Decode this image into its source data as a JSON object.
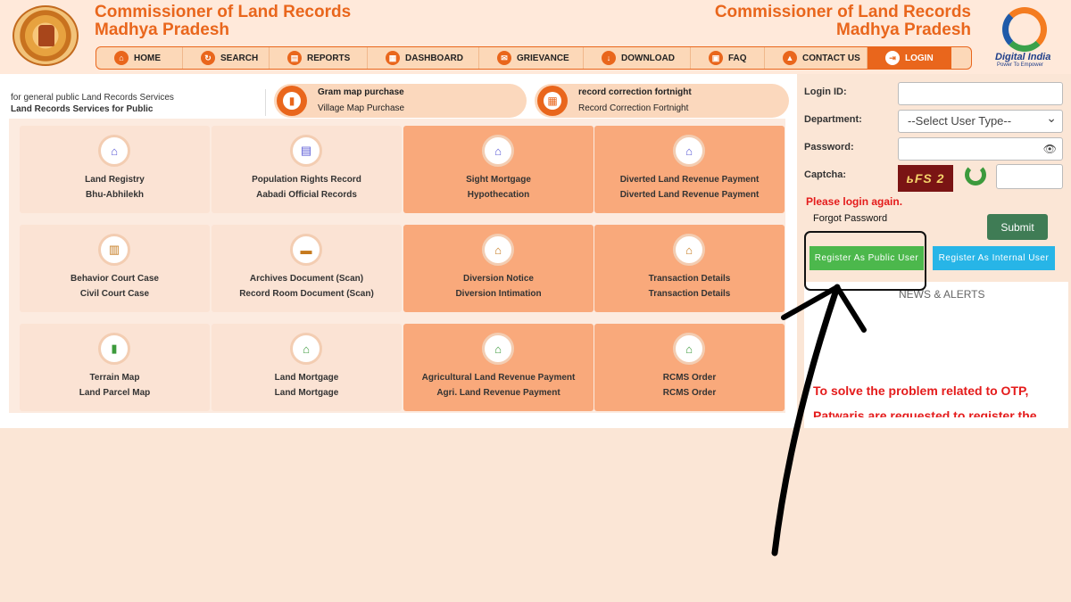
{
  "header": {
    "title_line1": "Commissioner of Land Records",
    "title_line2": "Madhya Pradesh",
    "digital_india": "Digital India",
    "digital_india_tagline": "Power To Empower"
  },
  "nav": [
    {
      "label": "HOME",
      "icon": "home-icon",
      "glyph": "⌂"
    },
    {
      "label": "SEARCH",
      "icon": "search-icon",
      "glyph": "↻"
    },
    {
      "label": "REPORTS",
      "icon": "reports-icon",
      "glyph": "▤"
    },
    {
      "label": "DASHBOARD",
      "icon": "dashboard-icon",
      "glyph": "▦"
    },
    {
      "label": "GRIEVANCE",
      "icon": "grievance-icon",
      "glyph": "✉"
    },
    {
      "label": "DOWNLOAD",
      "icon": "download-icon",
      "glyph": "↓"
    },
    {
      "label": "FAQ",
      "icon": "faq-icon",
      "glyph": "▣"
    },
    {
      "label": "CONTACT US",
      "icon": "contact-icon",
      "glyph": "▲"
    },
    {
      "label": "LOGIN",
      "icon": "login-icon",
      "glyph": "⇥"
    }
  ],
  "intro": {
    "line1": "for general public Land Records Services",
    "line2": "Land Records Services for Public"
  },
  "pills": [
    {
      "title": "Gram map purchase",
      "subtitle": "Village Map Purchase",
      "icon": "map-icon"
    },
    {
      "title": "record correction fortnight",
      "subtitle": "Record Correction Fortnight",
      "icon": "calendar-icon"
    }
  ],
  "tiles": [
    {
      "line1": "Land Registry",
      "line2": "Bhu-Abhilekh",
      "icon": "house-icon"
    },
    {
      "line1": "Population Rights Record",
      "line2": "Aabadi Official Records",
      "icon": "register-icon"
    },
    {
      "line1": "Sight Mortgage",
      "line2": "Hypothecation",
      "icon": "house-icon"
    },
    {
      "line1": "Diverted Land Revenue Payment",
      "line2": "Diverted Land Revenue Payment",
      "icon": "house-icon"
    },
    {
      "line1": "Behavior Court Case",
      "line2": "Civil Court Case",
      "icon": "court-icon"
    },
    {
      "line1": "Archives Document (Scan)",
      "line2": "Record Room Document (Scan)",
      "icon": "folder-icon"
    },
    {
      "line1": "Diversion Notice",
      "line2": "Diversion Intimation",
      "icon": "house-icon"
    },
    {
      "line1": "Transaction Details",
      "line2": "Transaction Details",
      "icon": "house-icon"
    },
    {
      "line1": "Terrain Map",
      "line2": "Land Parcel Map",
      "icon": "book-icon"
    },
    {
      "line1": "Land Mortgage",
      "line2": "Land Mortgage",
      "icon": "house-icon"
    },
    {
      "line1": "Agricultural Land Revenue Payment",
      "line2": "Agri. Land Revenue Payment",
      "icon": "house-icon"
    },
    {
      "line1": "RCMS Order",
      "line2": "RCMS Order",
      "icon": "house-icon"
    }
  ],
  "login": {
    "login_id_label": "Login ID:",
    "department_label": "Department:",
    "department_value": "--Select User Type--",
    "password_label": "Password:",
    "captcha_label": "Captcha:",
    "captcha_text": "ьFS 2",
    "error": "Please login again.",
    "forgot": "Forgot Password",
    "submit": "Submit",
    "register_public": "Register As Public User",
    "register_internal": "Register As Internal User",
    "news_title": "NEWS & ALERTS",
    "alert_line1": "To solve the problem related to OTP,",
    "alert_line2": "Patwaris are requested to register the"
  },
  "colors": {
    "brand_orange": "#e9661c",
    "submit_green": "#3f7c55",
    "public_green": "#4cb84c",
    "internal_blue": "#27b5e7",
    "error_red": "#e41b1b"
  }
}
